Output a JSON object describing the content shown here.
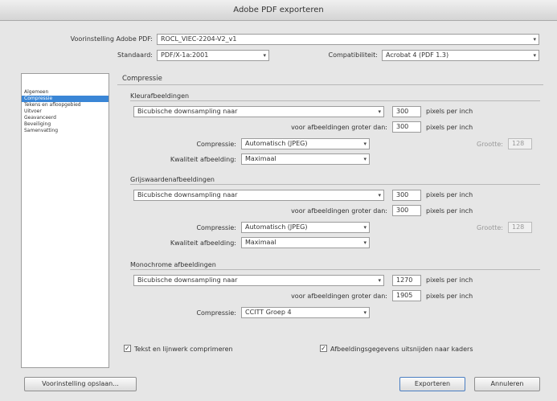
{
  "window": {
    "title": "Adobe PDF exporteren"
  },
  "top": {
    "preset_label": "Voorinstelling Adobe PDF:",
    "preset_value": "ROCL_VIEC-2204-V2_v1",
    "standard_label": "Standaard:",
    "standard_value": "PDF/X-1a:2001",
    "compat_label": "Compatibiliteit:",
    "compat_value": "Acrobat 4 (PDF 1.3)"
  },
  "sidebar": {
    "items": [
      {
        "label": "Algemeen"
      },
      {
        "label": "Compressie"
      },
      {
        "label": "Tekens en afloopgebied"
      },
      {
        "label": "Uitvoer"
      },
      {
        "label": "Geavanceerd"
      },
      {
        "label": "Beveiliging"
      },
      {
        "label": "Samenvatting"
      }
    ]
  },
  "panel": {
    "title": "Compressie",
    "color": {
      "title": "Kleurafbeeldingen",
      "sampling": "Bicubische downsampling naar",
      "ppi": "300",
      "ppi_unit": "pixels per inch",
      "greater_label": "voor afbeeldingen groter dan:",
      "greater_value": "300",
      "greater_unit": "pixels per inch",
      "compression_label": "Compressie:",
      "compression_value": "Automatisch (JPEG)",
      "tile_label": "Grootte:",
      "tile_value": "128",
      "quality_label": "Kwaliteit afbeelding:",
      "quality_value": "Maximaal"
    },
    "gray": {
      "title": "Grijswaardenafbeeldingen",
      "sampling": "Bicubische downsampling naar",
      "ppi": "300",
      "ppi_unit": "pixels per inch",
      "greater_label": "voor afbeeldingen groter dan:",
      "greater_value": "300",
      "greater_unit": "pixels per inch",
      "compression_label": "Compressie:",
      "compression_value": "Automatisch (JPEG)",
      "tile_label": "Grootte:",
      "tile_value": "128",
      "quality_label": "Kwaliteit afbeelding:",
      "quality_value": "Maximaal"
    },
    "mono": {
      "title": "Monochrome afbeeldingen",
      "sampling": "Bicubische downsampling naar",
      "ppi": "1270",
      "ppi_unit": "pixels per inch",
      "greater_label": "voor afbeeldingen groter dan:",
      "greater_value": "1905",
      "greater_unit": "pixels per inch",
      "compression_label": "Compressie:",
      "compression_value": "CCITT Groep 4"
    },
    "compress_text_label": "Tekst en lijnwerk comprimeren",
    "crop_label": "Afbeeldingsgegevens uitsnijden naar kaders"
  },
  "footer": {
    "save_preset": "Voorinstelling opslaan...",
    "export": "Exporteren",
    "cancel": "Annuleren"
  }
}
